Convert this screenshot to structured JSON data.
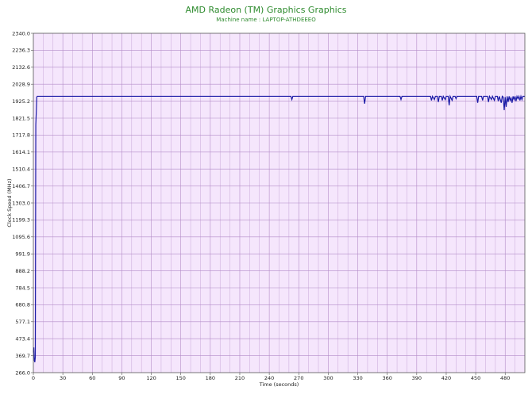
{
  "chart_data": {
    "type": "line",
    "title": "AMD Radeon (TM) Graphics Graphics",
    "subtitle": "Machine name : LAPTOP-ATHDEEEO",
    "xlabel": "Time (seconds)",
    "ylabel": "Clock Speed (MHz)",
    "xlim": [
      0,
      500
    ],
    "ylim": [
      266.0,
      2340.0
    ],
    "xticks": [
      0,
      30,
      60,
      90,
      120,
      150,
      180,
      210,
      240,
      270,
      300,
      330,
      360,
      390,
      420,
      450,
      480
    ],
    "yticks": [
      "266.0",
      "369.7",
      "473.4",
      "577.1",
      "680.8",
      "784.5",
      "888.2",
      "991.9",
      "1095.6",
      "1199.3",
      "1303.0",
      "1406.7",
      "1510.4",
      "1614.1",
      "1717.8",
      "1821.5",
      "1925.2",
      "2028.9",
      "2132.6",
      "2236.3",
      "2340.0"
    ],
    "grid": true,
    "colors": {
      "plot_bg": "#f5e6fc",
      "grid": "#b48cc8",
      "line": "#1a1aa6",
      "title": "#2e8b2e"
    },
    "series": [
      {
        "values": [
          [
            0,
            390
          ],
          [
            0.5,
            420
          ],
          [
            1,
            340
          ],
          [
            1.5,
            330
          ],
          [
            2,
            360
          ],
          [
            2.5,
            1780
          ],
          [
            3,
            1860
          ],
          [
            3.5,
            1950
          ],
          [
            4,
            1955
          ],
          [
            262,
            1955
          ],
          [
            263,
            1935
          ],
          [
            264,
            1955
          ],
          [
            336,
            1955
          ],
          [
            337,
            1910
          ],
          [
            338,
            1955
          ],
          [
            373,
            1955
          ],
          [
            374,
            1935
          ],
          [
            375,
            1955
          ],
          [
            404,
            1955
          ],
          [
            405,
            1930
          ],
          [
            406,
            1955
          ],
          [
            408,
            1935
          ],
          [
            409,
            1955
          ],
          [
            411,
            1955
          ],
          [
            412,
            1920
          ],
          [
            413,
            1955
          ],
          [
            415,
            1955
          ],
          [
            416,
            1930
          ],
          [
            417,
            1955
          ],
          [
            419,
            1935
          ],
          [
            420,
            1955
          ],
          [
            422,
            1955
          ],
          [
            423,
            1900
          ],
          [
            424,
            1955
          ],
          [
            426,
            1930
          ],
          [
            427,
            1955
          ],
          [
            429,
            1955
          ],
          [
            430,
            1940
          ],
          [
            431,
            1955
          ],
          [
            451,
            1955
          ],
          [
            452,
            1915
          ],
          [
            453,
            1955
          ],
          [
            456,
            1955
          ],
          [
            457,
            1930
          ],
          [
            458,
            1955
          ],
          [
            462,
            1955
          ],
          [
            463,
            1920
          ],
          [
            464,
            1955
          ],
          [
            466,
            1935
          ],
          [
            467,
            1955
          ],
          [
            469,
            1930
          ],
          [
            470,
            1955
          ],
          [
            472,
            1955
          ],
          [
            473,
            1925
          ],
          [
            474,
            1955
          ],
          [
            476,
            1915
          ],
          [
            477,
            1955
          ],
          [
            478,
            1950
          ],
          [
            479,
            1870
          ],
          [
            480,
            1950
          ],
          [
            481,
            1890
          ],
          [
            482,
            1955
          ],
          [
            483,
            1920
          ],
          [
            484,
            1955
          ],
          [
            485,
            1930
          ],
          [
            486,
            1945
          ],
          [
            487,
            1915
          ],
          [
            488,
            1955
          ],
          [
            489,
            1935
          ],
          [
            490,
            1955
          ],
          [
            491,
            1925
          ],
          [
            492,
            1955
          ],
          [
            493,
            1940
          ],
          [
            494,
            1955
          ],
          [
            495,
            1930
          ],
          [
            496,
            1955
          ],
          [
            497,
            1935
          ],
          [
            498,
            1955
          ],
          [
            500,
            1955
          ]
        ]
      }
    ]
  }
}
